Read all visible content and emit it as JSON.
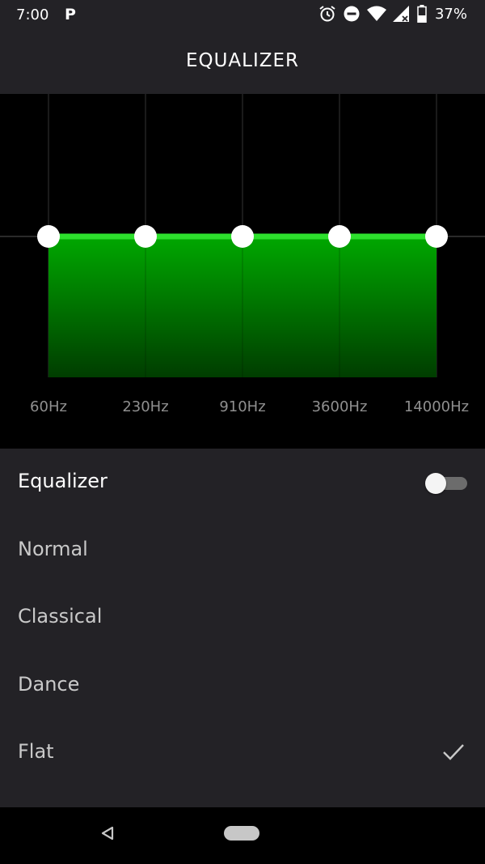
{
  "status_bar": {
    "time": "7:00",
    "notification_icon": "P",
    "icons": [
      "alarm-icon",
      "do-not-disturb-icon",
      "wifi-icon",
      "signal-icon",
      "battery-icon"
    ],
    "battery": "37%"
  },
  "header": {
    "title": "EQUALIZER"
  },
  "equalizer": {
    "bands": [
      {
        "label": "60Hz",
        "gain": 0
      },
      {
        "label": "230Hz",
        "gain": 0
      },
      {
        "label": "910Hz",
        "gain": 0
      },
      {
        "label": "3600Hz",
        "gain": 0
      },
      {
        "label": "14000Hz",
        "gain": 0
      }
    ],
    "fill_color": "#00a000",
    "line_color": "#2de02d"
  },
  "settings": {
    "equalizer_label": "Equalizer",
    "equalizer_enabled": false,
    "presets": [
      {
        "label": "Normal",
        "selected": false
      },
      {
        "label": "Classical",
        "selected": false
      },
      {
        "label": "Dance",
        "selected": false
      },
      {
        "label": "Flat",
        "selected": true
      }
    ]
  },
  "nav_bar": {
    "icons": [
      "back-icon",
      "home-icon"
    ]
  }
}
